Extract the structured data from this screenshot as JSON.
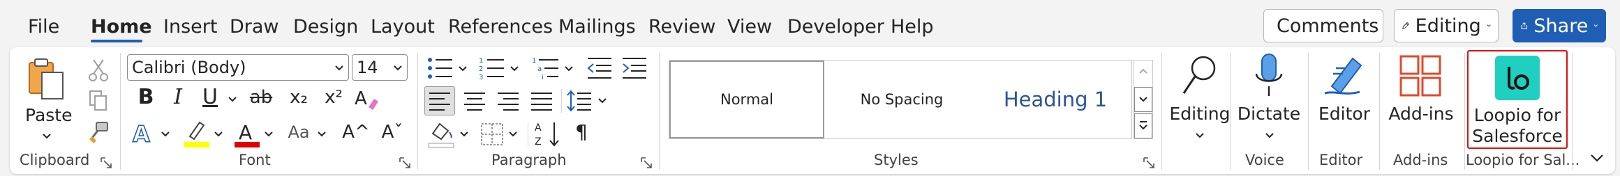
{
  "tabs": [
    {
      "label": "File",
      "active": false
    },
    {
      "label": "Home",
      "active": true
    },
    {
      "label": "Insert",
      "active": false
    },
    {
      "label": "Draw",
      "active": false
    },
    {
      "label": "Design",
      "active": false
    },
    {
      "label": "Layout",
      "active": false
    },
    {
      "label": "References",
      "active": false
    },
    {
      "label": "Mailings",
      "active": false
    },
    {
      "label": "Review",
      "active": false
    },
    {
      "label": "View",
      "active": false
    },
    {
      "label": "Developer",
      "active": false
    },
    {
      "label": "Help",
      "active": false
    }
  ],
  "top_buttons": {
    "comments": "Comments",
    "editing": "Editing",
    "share": "Share"
  },
  "clipboard": {
    "paste": "Paste",
    "label": "Clipboard"
  },
  "font": {
    "name": "Calibri (Body)",
    "size": "14",
    "bold": "B",
    "italic": "I",
    "underline": "U",
    "strike": "ab",
    "subscript": "x₂",
    "superscript": "x²",
    "change_case": "Aa",
    "grow": "A^",
    "shrink": "Aˇ",
    "label": "Font"
  },
  "paragraph": {
    "pilcrow": "¶",
    "label": "Paragraph"
  },
  "styles": {
    "items": [
      "Normal",
      "No Spacing",
      "Heading 1"
    ],
    "label": "Styles"
  },
  "editing": {
    "label": "Editing"
  },
  "voice": {
    "button": "Dictate",
    "label": "Voice"
  },
  "editor": {
    "button": "Editor",
    "label": "Editor"
  },
  "addins": {
    "button": "Add-ins",
    "label": "Add-ins"
  },
  "loopio": {
    "button_line1": "Loopio for",
    "button_line2": "Salesforce",
    "label": "Loopio for Sal..."
  },
  "colors": {
    "accent": "#1f5eb5",
    "highlight": "#ffff00",
    "font_color": "#e00000",
    "loopio": "#1fd0c0",
    "loopio_border": "#e01010",
    "addins": "#e0492a"
  }
}
